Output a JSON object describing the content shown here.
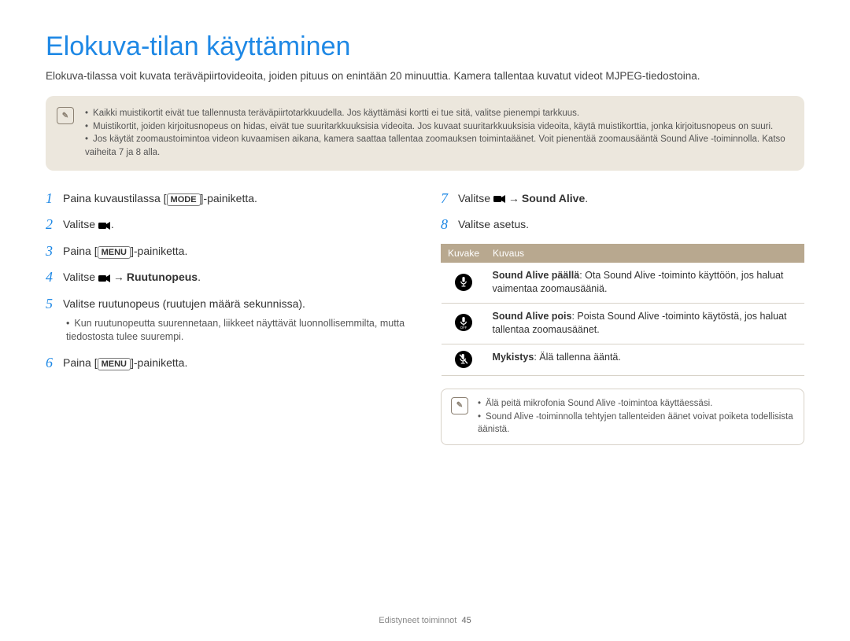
{
  "title": "Elokuva-tilan käyttäminen",
  "intro": "Elokuva-tilassa voit kuvata teräväpiirtovideoita, joiden pituus on enintään 20 minuuttia. Kamera tallentaa kuvatut videot MJPEG-tiedostoina.",
  "note_icon_label": "✎",
  "notes": [
    "Kaikki muistikortit eivät tue tallennusta teräväpiirtotarkkuudella. Jos käyttämäsi kortti ei tue sitä, valitse pienempi tarkkuus.",
    "Muistikortit, joiden kirjoitusnopeus on hidas, eivät tue suuritarkkuuksisia videoita. Jos kuvaat suuritarkkuuksisia videoita, käytä muistikorttia, jonka kirjoitusnopeus on suuri.",
    "Jos käytät zoomaustoimintoa videon kuvaamisen aikana, kamera saattaa tallentaa zoomauksen toimintaäänet. Voit pienentää zoomausääntä Sound Alive -toiminnolla. Katso vaiheita 7 ja 8 alla."
  ],
  "keys": {
    "mode": "MODE",
    "menu": "MENU"
  },
  "bold": {
    "ruutunopeus": "Ruutunopeus",
    "sound_alive": "Sound Alive"
  },
  "left_steps": {
    "s1_a": "Paina kuvaustilassa [",
    "s1_b": "]-painiketta.",
    "s2": "Valitse ",
    "s2_dot": ".",
    "s3_a": "Paina [",
    "s3_b": "]-painiketta.",
    "s4_a": "Valitse ",
    "s4_b": ".",
    "s5": "Valitse ruutunopeus (ruutujen määrä sekunnissa).",
    "s5_sub": "Kun ruutunopeutta suurennetaan, liikkeet näyttävät luonnollisemmilta, mutta tiedostosta tulee suurempi.",
    "s6_a": "Paina [",
    "s6_b": "]-painiketta."
  },
  "right_steps": {
    "s7_a": "Valitse ",
    "s7_b": ".",
    "s8": "Valitse asetus."
  },
  "arrow": "→",
  "table": {
    "h1": "Kuvake",
    "h2": "Kuvaus",
    "row1_label": "Sound Alive päällä",
    "row1_text": ": Ota Sound Alive -toiminto käyttöön, jos haluat vaimentaa zoomausääniä.",
    "row2_label": "Sound Alive pois",
    "row2_text": ": Poista Sound Alive -toiminto käytöstä, jos haluat tallentaa zoomausäänet.",
    "row3_label": "Mykistys",
    "row3_text": ": Älä tallenna ääntä."
  },
  "subnotes": [
    "Älä peitä mikrofonia Sound Alive -toimintoa käyttäessäsi.",
    "Sound Alive -toiminnolla tehtyjen tallenteiden äänet voivat poiketa todellisista äänistä."
  ],
  "footer": {
    "section": "Edistyneet toiminnot",
    "page": "45"
  }
}
